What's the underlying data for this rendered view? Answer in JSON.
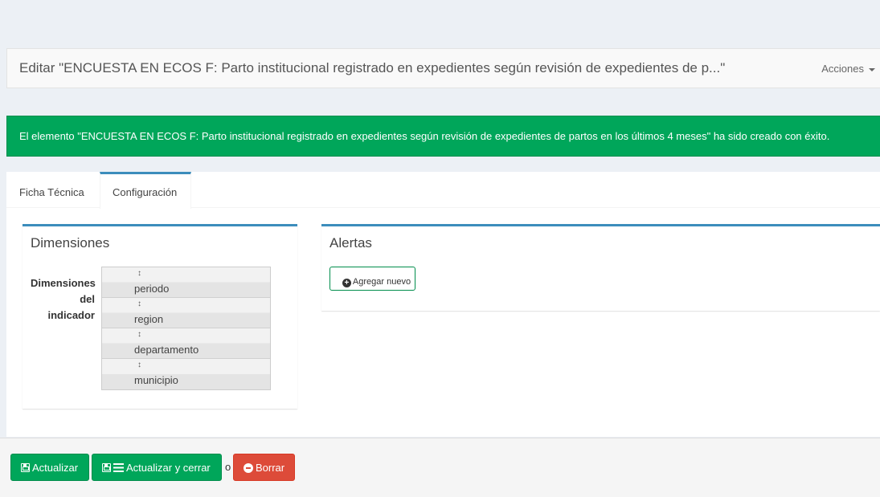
{
  "header": {
    "title": "Editar \"ENCUESTA EN ECOS F: Parto institucional registrado en expedientes según revisión de expedientes de p...\"",
    "actions_label": "Acciones"
  },
  "alert": {
    "message": "El elemento \"ENCUESTA EN ECOS F: Parto institucional registrado en expedientes según revisión de expedientes de partos en los últimos 4 meses\" ha sido creado con éxito."
  },
  "tabs": [
    {
      "label": "Ficha Técnica",
      "active": false
    },
    {
      "label": "Configuración",
      "active": true
    }
  ],
  "dimensiones_box": {
    "title": "Dimensiones",
    "field_label": "Dimensiones del indicador",
    "items": [
      "periodo",
      "region",
      "departamento",
      "municipio"
    ],
    "drag_glyph": "↕"
  },
  "alertas_box": {
    "title": "Alertas",
    "add_button_label": "Agregar nuevo"
  },
  "footer": {
    "update_label": "Actualizar",
    "update_close_label": "Actualizar y cerrar",
    "or_label": "o",
    "delete_label": "Borrar"
  },
  "colors": {
    "success": "#00a65a",
    "danger": "#dd4b39",
    "primary": "#3c8dbc"
  }
}
